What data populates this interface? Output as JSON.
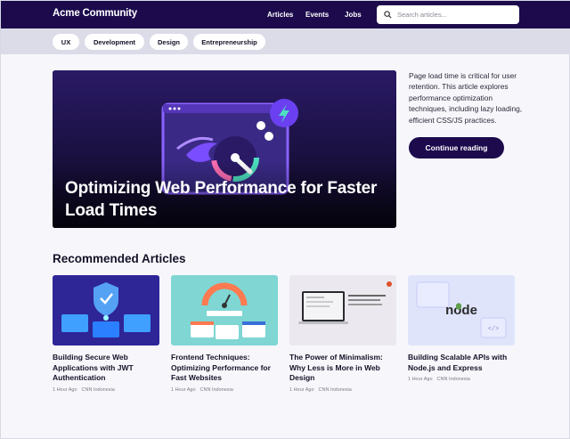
{
  "header": {
    "brand": "Acme Community",
    "nav": [
      "Articles",
      "Events",
      "Jobs"
    ],
    "search_placeholder": "Search articles..."
  },
  "categories": [
    "UX",
    "Development",
    "Design",
    "Entrepreneurship"
  ],
  "featured": {
    "title": "Optimizing Web Performance for Faster Load Times",
    "excerpt": "Page load time is critical for user retention. This article explores performance optimization techniques, including lazy loading, efficient CSS/JS practices.",
    "cta": "Continue reading"
  },
  "recommended": {
    "heading": "Recommended Articles",
    "articles": [
      {
        "title": "Building Secure Web Applications with JWT Authentication",
        "time": "1 Hour Ago",
        "source": "CNN Indonesia",
        "thumb": "security-illustration"
      },
      {
        "title": "Frontend Techniques: Optimizing Performance for Fast Websites",
        "time": "1 Hour Ago",
        "source": "CNN Indonesia",
        "thumb": "performance-gauge-illustration"
      },
      {
        "title": "The Power of Minimalism: Why Less is More in Web Design",
        "time": "1 Hour Ago",
        "source": "CNN Indonesia",
        "thumb": "minimal-laptop-illustration"
      },
      {
        "title": "Building Scalable APIs with Node.js and Express",
        "time": "1 Hour Ago",
        "source": "CNN Indonesia",
        "thumb": "nodejs-logo-illustration"
      }
    ]
  },
  "colors": {
    "primary": "#1c0a4d",
    "chip_bar": "#dcdbe8",
    "background": "#f7f7fb"
  }
}
